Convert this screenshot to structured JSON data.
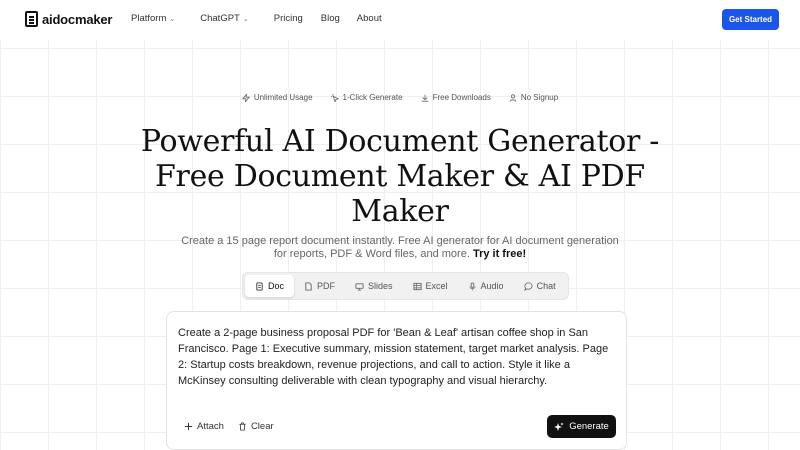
{
  "brand": {
    "name": "aidocmaker",
    "accent": "#1a56e8"
  },
  "nav": {
    "links": [
      {
        "label": "Platform",
        "has_dropdown": true
      },
      {
        "label": "ChatGPT",
        "has_dropdown": true
      },
      {
        "label": "Pricing",
        "has_dropdown": false
      },
      {
        "label": "Blog",
        "has_dropdown": false
      },
      {
        "label": "About",
        "has_dropdown": false
      }
    ],
    "cta_label": "Get Started"
  },
  "features": [
    {
      "icon": "bolt-icon",
      "label": "Unlimited Usage"
    },
    {
      "icon": "cursor-click-icon",
      "label": "1-Click Generate"
    },
    {
      "icon": "download-icon",
      "label": "Free Downloads"
    },
    {
      "icon": "user-icon",
      "label": "No Signup"
    }
  ],
  "hero": {
    "title_lines": [
      "Powerful AI Document Generator -",
      "Free Document Maker & AI PDF",
      "Maker"
    ],
    "subtitle": "Create a 15 page report document instantly. Free AI generator for AI document generation for reports, PDF & Word files, and more.",
    "subtitle_cta": "Try it free!"
  },
  "tabs": [
    {
      "icon": "doc-icon",
      "label": "Doc",
      "active": true
    },
    {
      "icon": "pdf-icon",
      "label": "PDF",
      "active": false
    },
    {
      "icon": "slides-icon",
      "label": "Slides",
      "active": false
    },
    {
      "icon": "excel-icon",
      "label": "Excel",
      "active": false
    },
    {
      "icon": "mic-icon",
      "label": "Audio",
      "active": false
    },
    {
      "icon": "chat-icon",
      "label": "Chat",
      "active": false
    }
  ],
  "prompt": {
    "value": "Create a 2-page business proposal PDF for 'Bean & Leaf' artisan coffee shop in San Francisco. Page 1: Executive summary, mission statement, target market analysis. Page 2: Startup costs breakdown, revenue projections, and call to action. Style it like a McKinsey consulting deliverable with clean typography and visual hierarchy.",
    "attach_label": "Attach",
    "clear_label": "Clear",
    "generate_label": "Generate"
  }
}
